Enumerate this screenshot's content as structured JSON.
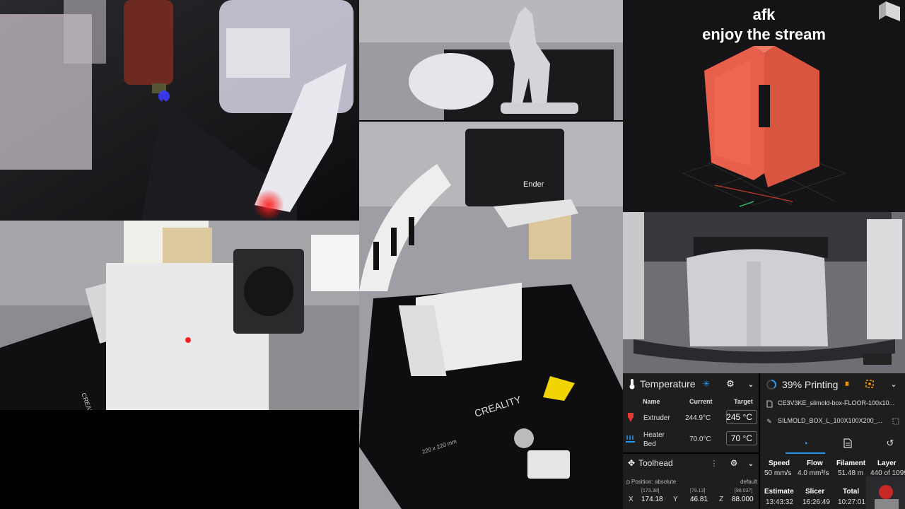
{
  "overlay": {
    "line1": "afk",
    "line2": "enjoy the stream"
  },
  "printer_labels": {
    "brand": "CREALITY",
    "bed_size": "220 x 220 mm",
    "head_brand": "Ender"
  },
  "temperature": {
    "title": "Temperature",
    "col_name": "Name",
    "col_current": "Current",
    "col_target": "Target",
    "rows": [
      {
        "name": "Extruder",
        "current": "244.9°C",
        "target": "245",
        "unit": "°C"
      },
      {
        "name": "Heater Bed",
        "current": "70.0°C",
        "target": "70",
        "unit": "°C"
      }
    ]
  },
  "toolhead": {
    "title": "Toolhead",
    "position_mode": "Position: absolute",
    "default_label": "default",
    "x": {
      "label": "X",
      "value": "174.18",
      "sub": "[173.38]"
    },
    "y": {
      "label": "Y",
      "value": "46.81",
      "sub": "[79.13]"
    },
    "z": {
      "label": "Z",
      "value": "88.000",
      "sub": "[88.037]"
    }
  },
  "status": {
    "title": "39% Printing",
    "file1": "CE3V3KE_silmold-box-FLOOR-100x10...",
    "file2": "SILMOLD_BOX_L_100X100X200_...",
    "progress": 0.39,
    "stats_row1": [
      {
        "label": "Speed",
        "value": "50 mm/s"
      },
      {
        "label": "Flow",
        "value": "4.0 mm³/s"
      },
      {
        "label": "Filament",
        "value": "51.48 m"
      },
      {
        "label": "Layer",
        "value": "440 of 1099"
      }
    ],
    "stats_row2": [
      {
        "label": "Estimate",
        "value": "13:43:32"
      },
      {
        "label": "Slicer",
        "value": "16:26:49"
      },
      {
        "label": "Total",
        "value": "10:27:01"
      }
    ]
  },
  "colors": {
    "accent": "#2196f3",
    "warning": "#ff9800",
    "model": "#e8604c"
  }
}
